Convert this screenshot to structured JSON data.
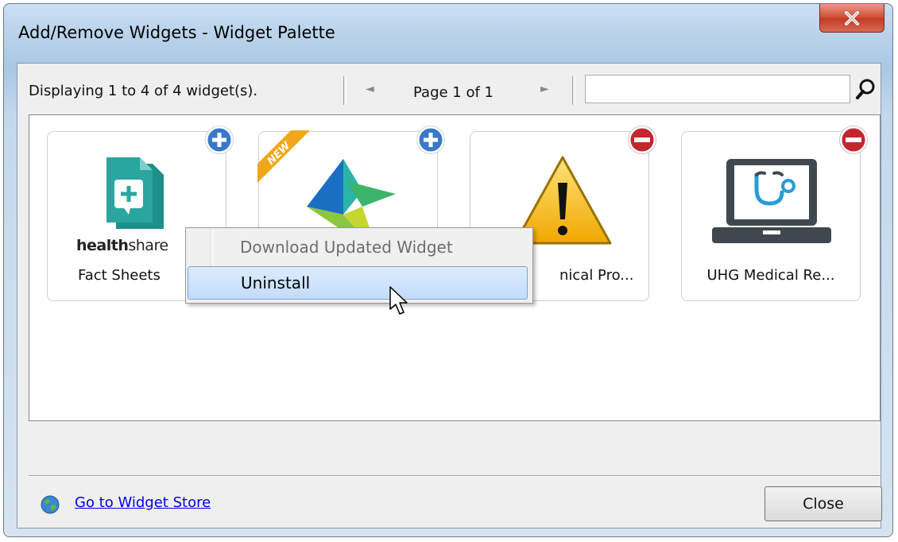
{
  "window": {
    "title": "Add/Remove Widgets - Widget Palette"
  },
  "toolbar": {
    "display_text": "Displaying 1 to 4 of 4 widget(s).",
    "page_text": "Page 1 of 1",
    "search_value": "",
    "search_placeholder": ""
  },
  "widgets": [
    {
      "label": "Fact Sheets",
      "logo_text_bold": "health",
      "logo_text": "share",
      "action": "add",
      "is_new": false
    },
    {
      "label": "",
      "action": "add",
      "is_new": true,
      "new_text": "NEW"
    },
    {
      "label": "nical Pro...",
      "action": "remove",
      "is_new": false
    },
    {
      "label": "UHG Medical Re...",
      "action": "remove",
      "is_new": false
    }
  ],
  "context_menu": {
    "items": [
      {
        "label": "Download Updated Widget",
        "enabled": false
      },
      {
        "label": "Uninstall",
        "enabled": true,
        "hovered": true
      }
    ]
  },
  "footer": {
    "store_link": "Go to Widget Store",
    "close_label": "Close"
  },
  "colors": {
    "add_badge": "#3a78c9",
    "remove_badge": "#c4262e",
    "new_ribbon": "#f0a81a",
    "factsheet_teal": "#2aa5a0",
    "laptop_gray": "#40484f",
    "link": "#0000ee"
  }
}
